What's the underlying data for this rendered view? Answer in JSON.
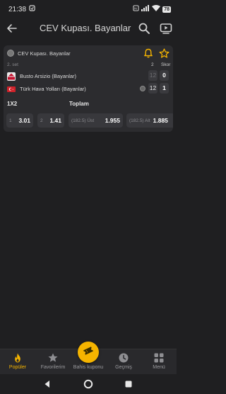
{
  "status": {
    "time": "21:38",
    "battery": "78"
  },
  "header": {
    "title": "CEV Kupası. Bayanlar"
  },
  "match": {
    "league": "CEV Kupası. Bayanlar",
    "set_label": "2. set",
    "col_set": "2",
    "col_score": "Skor",
    "teams": [
      {
        "name": "Busto Arsizio (Bayanlar)",
        "set_score": "12",
        "score": "0",
        "serving": false
      },
      {
        "name": "Türk Hava Yolları (Bayanlar)",
        "set_score": "12",
        "score": "1",
        "serving": true
      }
    ]
  },
  "markets": {
    "m1x2": {
      "title": "1X2",
      "odds": [
        {
          "label": "1",
          "value": "3.01"
        },
        {
          "label": "2",
          "value": "1.41"
        }
      ]
    },
    "total": {
      "title": "Toplam",
      "odds": [
        {
          "label": "(182.5) Üst",
          "value": "1.955"
        },
        {
          "label": "(182.5) Alt",
          "value": "1.885"
        }
      ]
    }
  },
  "nav": {
    "items": [
      {
        "label": "Popüler",
        "icon": "fire-icon"
      },
      {
        "label": "Favorilerim",
        "icon": "star-icon"
      },
      {
        "label": "Bahis kuponu",
        "icon": "ticket-icon"
      },
      {
        "label": "Geçmiş",
        "icon": "clock-icon"
      },
      {
        "label": "Menü",
        "icon": "grid-icon"
      }
    ]
  },
  "colors": {
    "accent": "#f5b400",
    "background": "#1f1f21",
    "card": "#2c2c2f"
  }
}
